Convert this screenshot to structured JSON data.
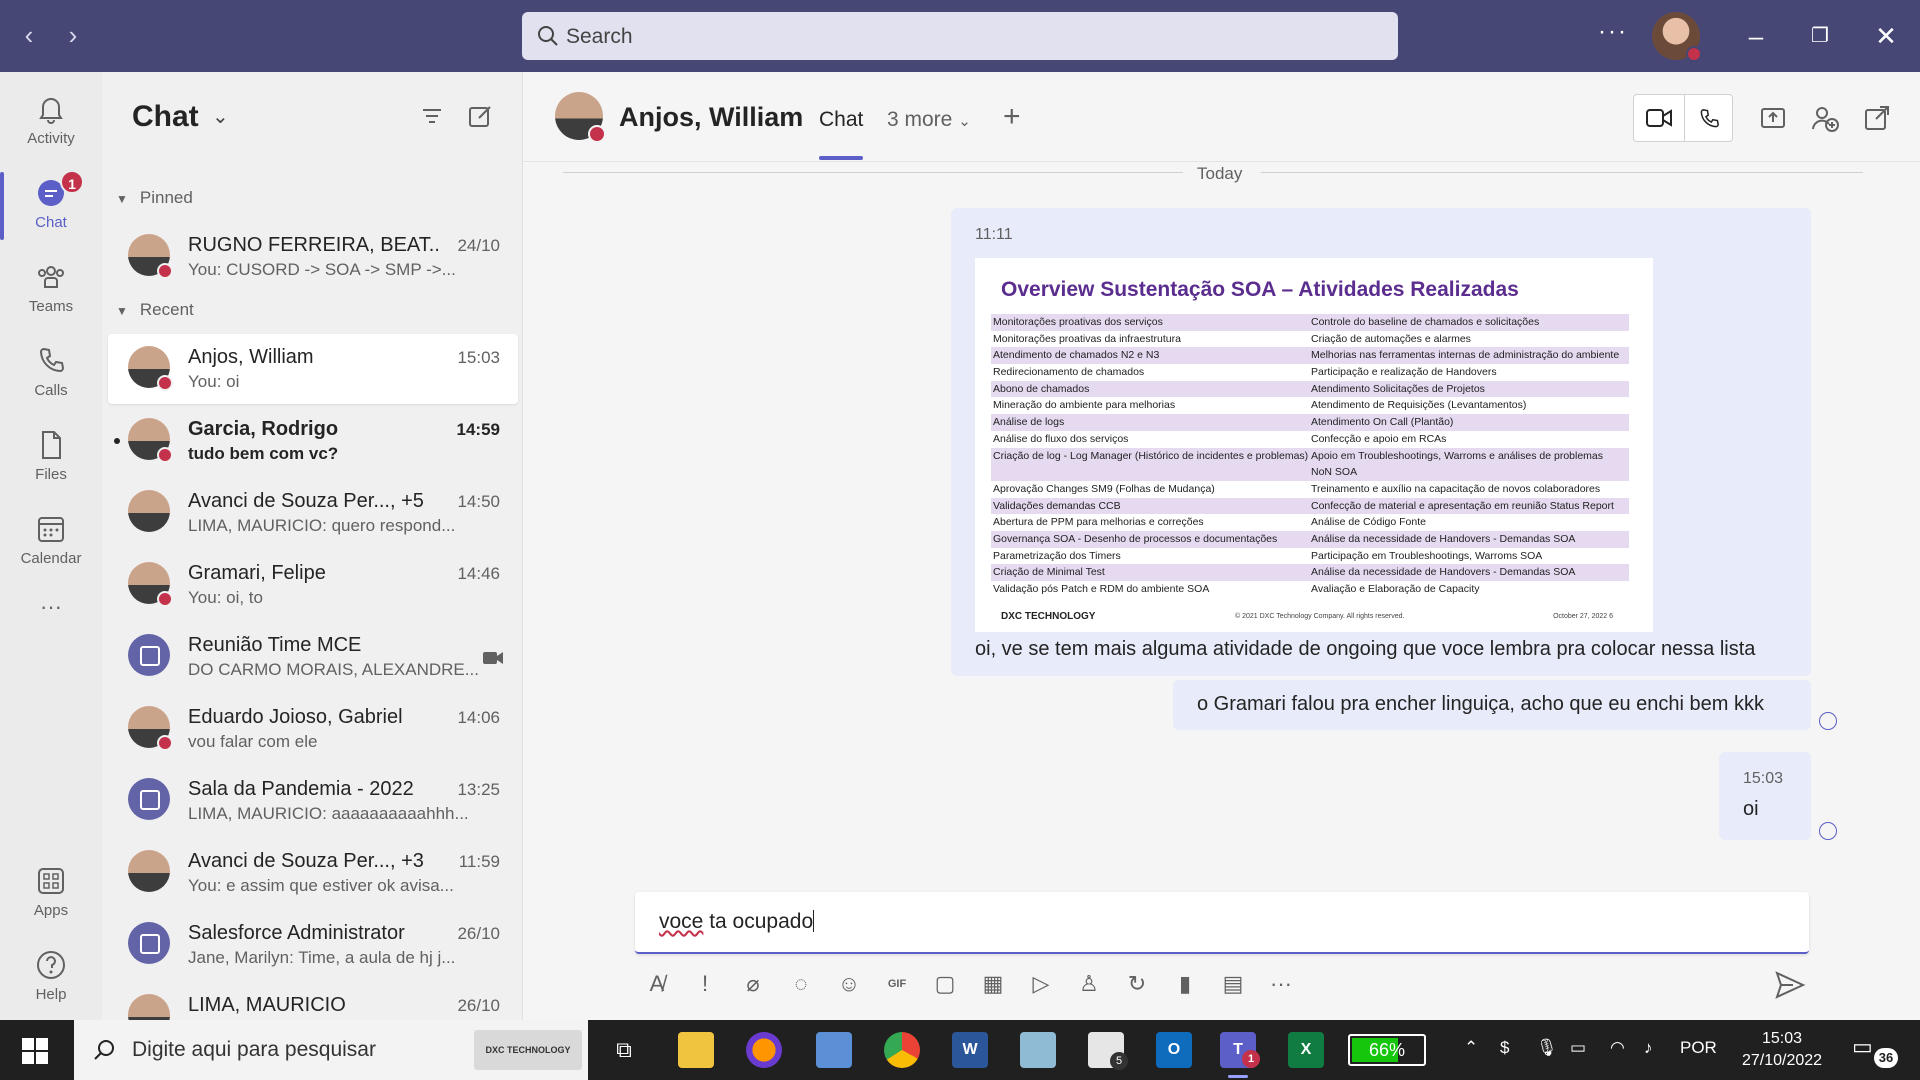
{
  "search": {
    "placeholder": "Search"
  },
  "titlebar": {
    "more": "···"
  },
  "rail": [
    {
      "label": "Activity"
    },
    {
      "label": "Chat",
      "badge": "1"
    },
    {
      "label": "Teams"
    },
    {
      "label": "Calls"
    },
    {
      "label": "Files"
    },
    {
      "label": "Calendar"
    },
    {
      "label": "···"
    },
    {
      "label": "Apps"
    },
    {
      "label": "Help"
    }
  ],
  "chatlist": {
    "title": "Chat",
    "pinned_label": "Pinned",
    "recent_label": "Recent",
    "pinned": [
      {
        "name": "RUGNO FERREIRA, BEAT...",
        "preview": "You: CUSORD -> SOA -> SMP ->...",
        "time": "24/10"
      }
    ],
    "recent": [
      {
        "name": "Anjos, William",
        "preview": "You: oi",
        "time": "15:03"
      },
      {
        "name": "Garcia, Rodrigo",
        "preview": "tudo bem com vc?",
        "time": "14:59"
      },
      {
        "name": "Avanci de Souza Per..., +5",
        "preview": "LIMA, MAURICIO: quero respond...",
        "time": "14:50"
      },
      {
        "name": "Gramari, Felipe",
        "preview": "You: oi, to",
        "time": "14:46"
      },
      {
        "name": "Reunião Time MCE",
        "preview": "DO CARMO MORAIS, ALEXANDRE...",
        "time": ""
      },
      {
        "name": "Eduardo Joioso, Gabriel",
        "preview": "vou falar com ele",
        "time": "14:06"
      },
      {
        "name": "Sala da Pandemia - 2022",
        "preview": "LIMA, MAURICIO: aaaaaaaaaahhh...",
        "time": "13:25"
      },
      {
        "name": "Avanci de Souza Per..., +3",
        "preview": "You: e assim que estiver ok avisa...",
        "time": "11:59"
      },
      {
        "name": "Salesforce Administrator",
        "preview": "Jane, Marilyn: Time, a aula de hj j...",
        "time": "26/10"
      },
      {
        "name": "LIMA, MAURICIO",
        "preview": "",
        "time": "26/10"
      }
    ]
  },
  "conversation": {
    "name": "Anjos, William",
    "tab": "Chat",
    "more_tabs": "3 more",
    "divider": "Today",
    "messages": [
      {
        "time": "11:11",
        "text": "oi, ve se tem mais alguma atividade de ongoing que voce lembra pra colocar nessa lista"
      },
      {
        "text": "o Gramari falou pra encher linguiça, acho que eu enchi bem kkk"
      },
      {
        "time": "15:03",
        "text": "oi"
      }
    ],
    "slide": {
      "title": "Overview Sustentação SOA – Atividades Realizadas",
      "left": [
        "Monitorações proativas dos serviços",
        "Monitorações proativas da infraestrutura",
        "Atendimento de chamados N2 e N3",
        "Redirecionamento de chamados",
        "Abono de chamados",
        "Mineração do ambiente para melhorias",
        "Análise de logs",
        "Análise do fluxo dos serviços",
        "Criação de log - Log Manager (Histórico de incidentes e problemas)",
        "",
        "Aprovação Changes SM9 (Folhas de Mudança)",
        "Validações demandas CCB",
        "Abertura de PPM para melhorias e correções",
        "Governança SOA - Desenho de processos e documentações",
        "Parametrização dos Timers",
        "Criação de Minimal Test",
        "Validação pós Patch e RDM do ambiente SOA"
      ],
      "right": [
        "Controle do baseline de chamados e solicitações",
        "Criação de automações e alarmes",
        "Melhorias nas ferramentas internas de administração do ambiente",
        "Participação e realização de Handovers",
        "Atendimento Solicitações de Projetos",
        "Atendimento de Requisições (Levantamentos)",
        "Atendimento On Call (Plantão)",
        "Confecção e apoio em RCAs",
        "Apoio em Troubleshootings, Warroms e análises de problemas",
        "NoN SOA",
        "Treinamento e auxílio na capacitação de novos colaboradores",
        "Confecção de material e apresentação em reunião Status Report",
        "Análise de Código Fonte",
        "Análise da necessidade de Handovers - Demandas SOA",
        "Participação em Troubleshootings, Warroms SOA",
        "Análise da necessidade de Handovers - Demandas SOA",
        "Avaliação e Elaboração de Capacity"
      ],
      "footer_brand": "DXC TECHNOLOGY",
      "footer_copy": "© 2021 DXC Technology Company. All rights reserved.",
      "footer_date": "October 27, 2022      6"
    },
    "composer": {
      "spell_word": "voce",
      "rest": " ta ocupado"
    }
  },
  "taskbar": {
    "search_placeholder": "Digite aqui para pesquisar",
    "dxc_label": "DXC TECHNOLOGY",
    "battery": "66%",
    "battery_level": 0.66,
    "language": "POR",
    "time": "15:03",
    "date": "27/10/2022",
    "notifications": "36",
    "mail_badge": "5",
    "teams_badge": "1"
  },
  "colors": {
    "titlebar": "#464775",
    "accent": "#5b5fc7",
    "presence_busy": "#c4314b"
  }
}
